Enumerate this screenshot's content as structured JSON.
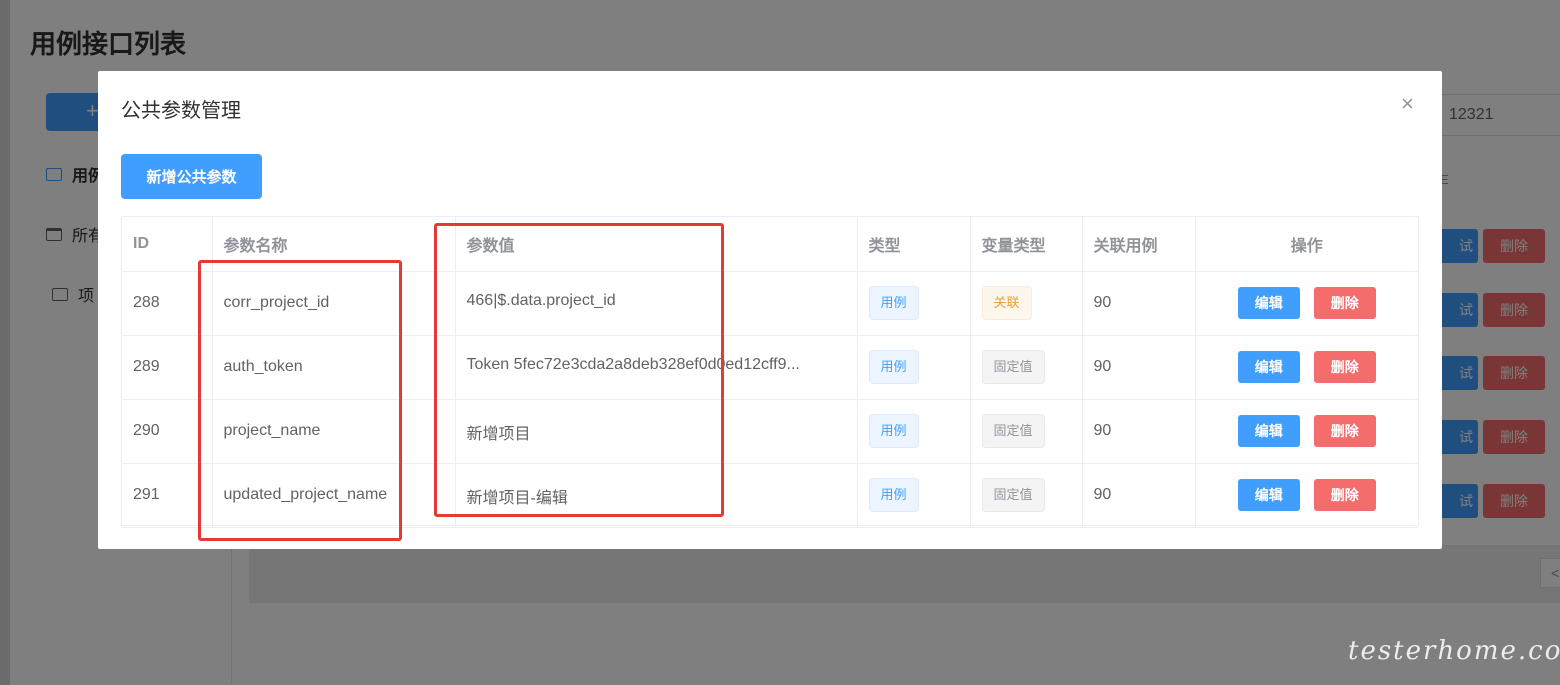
{
  "page": {
    "title": "用例接口列表",
    "add_button": "+",
    "sidebar": [
      {
        "label": "用例"
      },
      {
        "label": "所有"
      },
      {
        "label": "项"
      }
    ],
    "search_value": "12321",
    "small_text": "E",
    "row_buttons": {
      "test": "试",
      "delete": "删除"
    },
    "pager_arrow": "<"
  },
  "dialog": {
    "title": "公共参数管理",
    "close": "×",
    "add_button": "新增公共参数",
    "columns": {
      "id": "ID",
      "name": "参数名称",
      "value": "参数值",
      "type": "类型",
      "var_type": "变量类型",
      "linked_cases": "关联用例",
      "actions": "操作"
    },
    "rows": [
      {
        "id": "288",
        "name": "corr_project_id",
        "value": "466|$.data.project_id",
        "type": "用例",
        "var_type": "关联",
        "linked_cases": "90",
        "edit": "编辑",
        "delete": "删除"
      },
      {
        "id": "289",
        "name": "auth_token",
        "value": "Token 5fec72e3cda2a8deb328ef0d0ed12cff9...",
        "type": "用例",
        "var_type": "固定值",
        "linked_cases": "90",
        "edit": "编辑",
        "delete": "删除"
      },
      {
        "id": "290",
        "name": "project_name",
        "value": "新增项目",
        "type": "用例",
        "var_type": "固定值",
        "linked_cases": "90",
        "edit": "编辑",
        "delete": "删除"
      },
      {
        "id": "291",
        "name": "updated_project_name",
        "value": "新增项目-编辑",
        "type": "用例",
        "var_type": "固定值",
        "linked_cases": "90",
        "edit": "编辑",
        "delete": "删除"
      }
    ]
  },
  "watermark": "testerhome.com",
  "colors": {
    "primary": "#409eff",
    "danger": "#f56c6c",
    "warning": "#e6a23c",
    "highlight_box": "#e53935"
  }
}
